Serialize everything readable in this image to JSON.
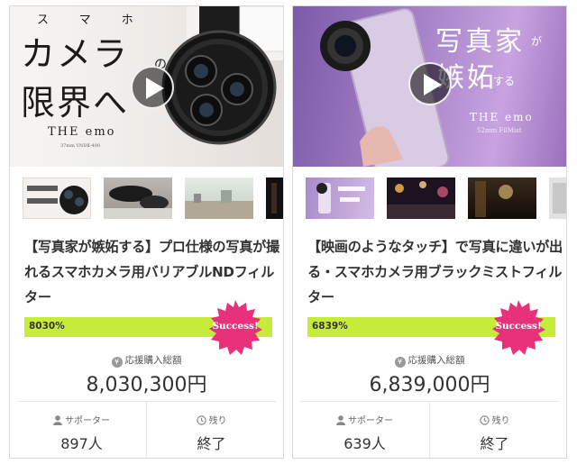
{
  "projects": [
    {
      "hero": {
        "kana": [
          "ス",
          "マ",
          "ホ"
        ],
        "line1": "カメラ",
        "particle": "の",
        "line2": "限界へ",
        "brand": "THE emo",
        "model": "37mm VNDⅡ-400"
      },
      "title": "【写真家が嫉妬する】プロ仕様の写真が撮れるスマホカメラ用バリアブルNDフィルター",
      "percent_label": "8030%",
      "percent": 8030,
      "badge": "Success!",
      "amount_label": "応援購入総額",
      "amount": "8,030,300円",
      "supporters_label": "サポーター",
      "supporters": "897人",
      "remaining_label": "残り",
      "remaining": "終了"
    },
    {
      "hero": {
        "line1": "写真家",
        "particle": "が",
        "line2": "嫉妬",
        "suffix": "する",
        "brand": "THE emo",
        "model": "52mm FilMist"
      },
      "title": "【映画のようなタッチ】で写真に違いが出る・スマホカメラ用ブラックミストフィルター",
      "percent_label": "6839%",
      "percent": 6839,
      "badge": "Success!",
      "amount_label": "応援購入総額",
      "amount": "6,839,000円",
      "supporters_label": "サポーター",
      "supporters": "639人",
      "remaining_label": "残り",
      "remaining": "終了"
    }
  ],
  "colors": {
    "progress_fill": "#c6ec3a",
    "progress_track": "#e6f5a0",
    "badge": "#e8317a"
  },
  "icons": [
    "play-icon",
    "yen-icon",
    "person-icon",
    "clock-icon",
    "success-badge-icon"
  ]
}
